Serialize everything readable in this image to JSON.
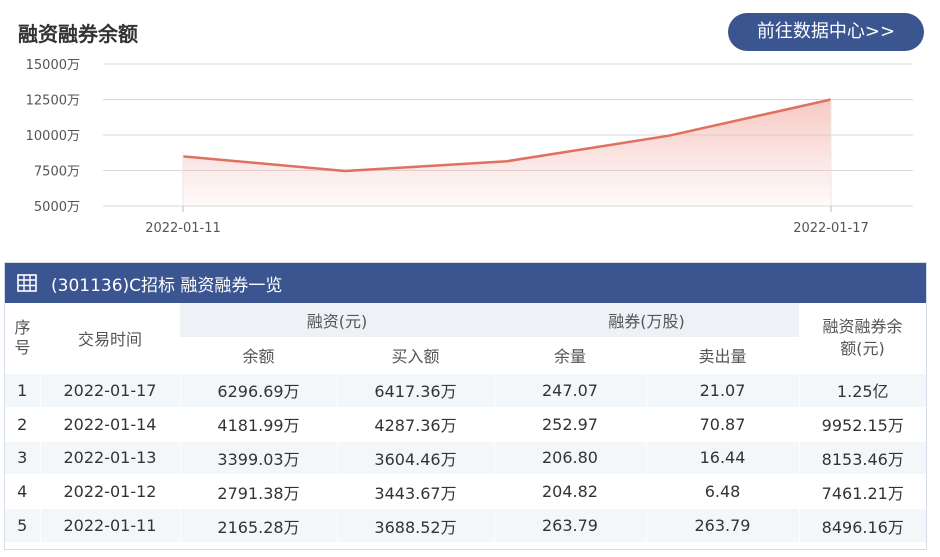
{
  "title": "融资融券余额",
  "data_center_button": "前往数据中心>>",
  "chart_data": {
    "type": "area",
    "x": [
      "2022-01-11",
      "2022-01-12",
      "2022-01-13",
      "2022-01-14",
      "2022-01-17"
    ],
    "x_tick_labels": [
      "2022-01-11",
      "2022-01-17"
    ],
    "y_tick_labels": [
      "15000万",
      "12500万",
      "10000万",
      "7500万",
      "5000万"
    ],
    "series": [
      {
        "values": [
          8496.16,
          7461.21,
          8153.46,
          9952.15,
          12500
        ]
      }
    ],
    "ylim": [
      5000,
      15000
    ],
    "grid": true,
    "colors": {
      "line": "#e07060",
      "fill": "#f3b8b0"
    }
  },
  "table": {
    "title": "(301136)C招标 融资融券一览",
    "headers": {
      "seq": "序号",
      "date": "交易时间",
      "margin_group": "融资(元)",
      "short_group": "融券(万股)",
      "total": "融资融券余额(元)",
      "margin_balance": "余额",
      "margin_buy": "买入额",
      "short_balance": "余量",
      "short_sell": "卖出量"
    },
    "rows": [
      [
        "1",
        "2022-01-17",
        "6296.69万",
        "6417.36万",
        "247.07",
        "21.07",
        "1.25亿"
      ],
      [
        "2",
        "2022-01-14",
        "4181.99万",
        "4287.36万",
        "252.97",
        "70.87",
        "9952.15万"
      ],
      [
        "3",
        "2022-01-13",
        "3399.03万",
        "3604.46万",
        "206.80",
        "16.44",
        "8153.46万"
      ],
      [
        "4",
        "2022-01-12",
        "2791.38万",
        "3443.67万",
        "204.82",
        "6.48",
        "7461.21万"
      ],
      [
        "5",
        "2022-01-11",
        "2165.28万",
        "3688.52万",
        "263.79",
        "263.79",
        "8496.16万"
      ]
    ]
  },
  "colors": {
    "accent": "#3a5590",
    "row_alt": "#f4f7fa"
  }
}
